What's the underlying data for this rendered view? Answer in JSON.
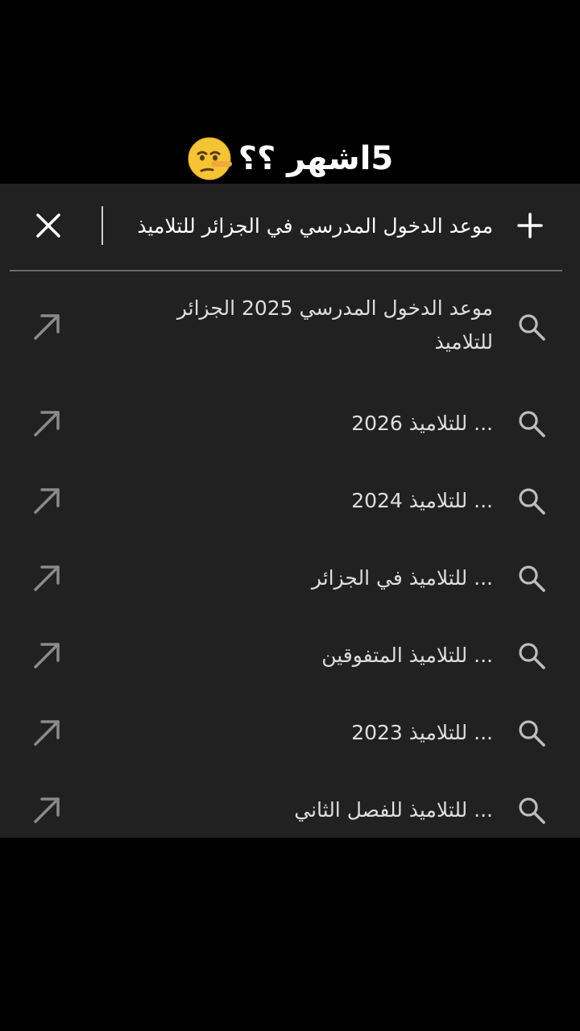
{
  "caption": {
    "text": "5اشهر ؟؟",
    "emoji": "lying-face-emoji"
  },
  "search": {
    "value": "موعد الدخول المدرسي في الجزائر للتلاميذ",
    "plus_icon": "plus-icon",
    "close_icon": "close-icon"
  },
  "suggestions": [
    {
      "label": "موعد الدخول المدرسي 2025 الجزائر للتلاميذ"
    },
    {
      "label": "... للتلاميذ 2026"
    },
    {
      "label": "... للتلاميذ 2024"
    },
    {
      "label": "... للتلاميذ في الجزائر"
    },
    {
      "label": "... للتلاميذ المتفوقين"
    },
    {
      "label": "... للتلاميذ 2023"
    },
    {
      "label": "... للتلاميذ للفصل الثاني"
    }
  ],
  "colors": {
    "background": "#000000",
    "panel": "#212121",
    "text": "#dedede",
    "icon": "#bdbdbd"
  }
}
